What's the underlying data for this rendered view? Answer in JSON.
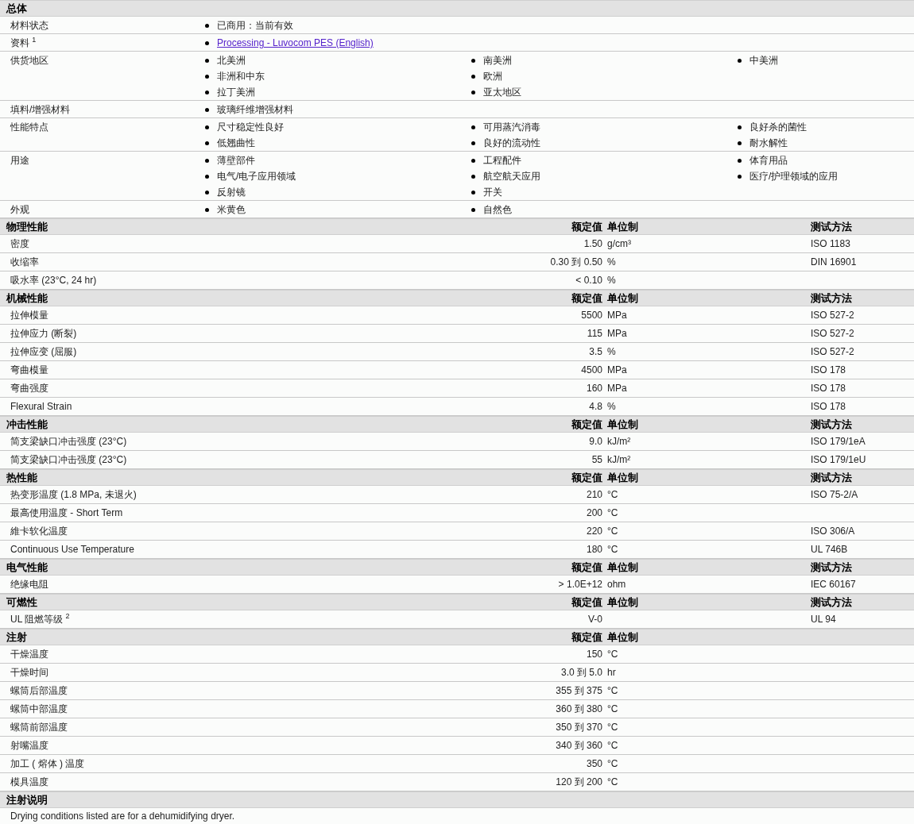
{
  "general": {
    "title": "总体",
    "rows": [
      {
        "label": "材料状态",
        "kind": "text",
        "columns": [
          [
            "已商用：当前有效"
          ]
        ]
      },
      {
        "label": "资料 $^{1}$",
        "kind": "link",
        "columns": [
          [
            "Processing - Luvocom PES (English)"
          ]
        ]
      },
      {
        "label": "供货地区",
        "kind": "text",
        "columns": [
          [
            "北美洲",
            "非洲和中东",
            "拉丁美洲"
          ],
          [
            "南美洲",
            "欧洲",
            "亚太地区"
          ],
          [
            "中美洲"
          ]
        ]
      },
      {
        "label": "填料/增强材料",
        "kind": "text",
        "columns": [
          [
            "玻璃纤维增强材料"
          ]
        ]
      },
      {
        "label": "性能特点",
        "kind": "text",
        "columns": [
          [
            "尺寸稳定性良好",
            "低翘曲性"
          ],
          [
            "可用蒸汽消毒",
            "良好的流动性"
          ],
          [
            "良好杀的菌性",
            "耐水解性"
          ]
        ]
      },
      {
        "label": "用途",
        "kind": "text",
        "columns": [
          [
            "薄壁部件",
            "电气/电子应用领域",
            "反射镜"
          ],
          [
            "工程配件",
            "航空航天应用",
            "开关"
          ],
          [
            "体育用品",
            "医疗/护理领域的应用"
          ]
        ]
      },
      {
        "label": "外观",
        "kind": "text",
        "columns": [
          [
            "米黄色"
          ],
          [
            "自然色"
          ]
        ]
      }
    ]
  },
  "sections": [
    {
      "title": "物理性能",
      "value_header": "额定值",
      "unit_header": "单位制",
      "method_header": "测试方法",
      "rows": [
        {
          "label": "密度",
          "value": "1.50",
          "unit": "g/cm³",
          "method": "ISO 1183"
        },
        {
          "label": "收缩率",
          "value": "0.30 到  0.50",
          "unit": "%",
          "method": "DIN 16901"
        },
        {
          "label": "吸水率  (23°C, 24 hr)",
          "value": "< 0.10",
          "unit": "%"
        }
      ]
    },
    {
      "title": "机械性能",
      "value_header": "额定值",
      "unit_header": "单位制",
      "method_header": "测试方法",
      "rows": [
        {
          "label": "拉伸模量",
          "value": "5500",
          "unit": "MPa",
          "method": "ISO 527-2"
        },
        {
          "label": "拉伸应力  (断裂)",
          "value": "115",
          "unit": "MPa",
          "method": "ISO 527-2"
        },
        {
          "label": "拉伸应变  (屈服)",
          "value": "3.5",
          "unit": "%",
          "method": "ISO 527-2"
        },
        {
          "label": "弯曲模量",
          "value": "4500",
          "unit": "MPa",
          "method": "ISO 178"
        },
        {
          "label": "弯曲强度",
          "value": "160",
          "unit": "MPa",
          "method": "ISO 178"
        },
        {
          "label": "Flexural Strain",
          "value": "4.8",
          "unit": "%",
          "method": "ISO 178"
        }
      ]
    },
    {
      "title": "冲击性能",
      "value_header": "额定值",
      "unit_header": "单位制",
      "method_header": "测试方法",
      "rows": [
        {
          "label": "简支梁缺口冲击强度  (23°C)",
          "value": "9.0",
          "unit": "kJ/m²",
          "method": "ISO 179/1eA"
        },
        {
          "label": "简支梁缺口冲击强度  (23°C)",
          "value": "55",
          "unit": "kJ/m²",
          "method": "ISO 179/1eU"
        }
      ]
    },
    {
      "title": "热性能",
      "value_header": "额定值",
      "unit_header": "单位制",
      "method_header": "测试方法",
      "rows": [
        {
          "label": "热变形温度  (1.8 MPa, 未退火)",
          "value": "210",
          "unit": "°C",
          "method": "ISO 75-2/A"
        },
        {
          "label": "最高使用温度  - Short Term",
          "value": "200",
          "unit": "°C"
        },
        {
          "label": "維卡软化温度",
          "value": "220",
          "unit": "°C",
          "method": "ISO 306/A"
        },
        {
          "label": "Continuous Use Temperature",
          "value": "180",
          "unit": "°C",
          "method": "UL 746B"
        }
      ]
    },
    {
      "title": "电气性能",
      "value_header": "额定值",
      "unit_header": "单位制",
      "method_header": "测试方法",
      "rows": [
        {
          "label": "绝缘电阻",
          "value": "> 1.0E+12",
          "unit": "ohm",
          "method": "IEC 60167"
        }
      ]
    },
    {
      "title": "可燃性",
      "value_header": "额定值",
      "unit_header": "单位制",
      "method_header": "测试方法",
      "rows": [
        {
          "label": "UL 阻燃等级 $^{2}$",
          "value": "V-0",
          "method": "UL 94"
        }
      ]
    },
    {
      "title": "注射",
      "value_header": "额定值",
      "unit_header": "单位制",
      "rows": [
        {
          "label": "干燥温度",
          "value": "150",
          "unit": "°C"
        },
        {
          "label": "干燥时间",
          "value": "3.0 到  5.0",
          "unit": "hr"
        },
        {
          "label": "螺筒后部温度",
          "value": "355 到  375",
          "unit": "°C"
        },
        {
          "label": "螺筒中部温度",
          "value": "360 到  380",
          "unit": "°C"
        },
        {
          "label": "螺筒前部温度",
          "value": "350 到  370",
          "unit": "°C"
        },
        {
          "label": "射嘴温度",
          "value": "340 到  360",
          "unit": "°C"
        },
        {
          "label": "加工 ( 熔体 ) 温度",
          "value": "350",
          "unit": "°C"
        },
        {
          "label": "模具温度",
          "value": "120 到  200",
          "unit": "°C"
        }
      ]
    }
  ],
  "notes": {
    "title": "注射说明",
    "text": "Drying conditions listed are for a dehumidifying dryer."
  }
}
